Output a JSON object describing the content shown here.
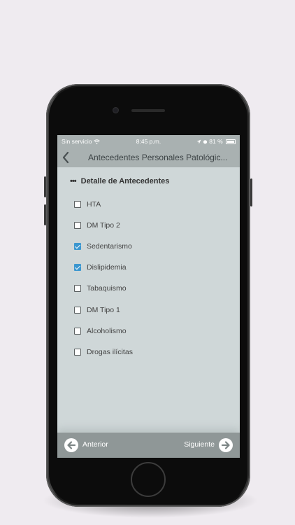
{
  "status_bar": {
    "carrier": "Sin servicio",
    "time": "8:45 p.m.",
    "battery": "81 %"
  },
  "nav": {
    "back_icon": "chevron-left-icon",
    "title": "Antecedentes Personales Patológic..."
  },
  "section": {
    "dots": "•••",
    "title": "Detalle de Antecedentes"
  },
  "options": [
    {
      "label": "HTA",
      "checked": false
    },
    {
      "label": "DM Tipo 2",
      "checked": false
    },
    {
      "label": "Sedentarismo",
      "checked": true
    },
    {
      "label": "Dislipidemia",
      "checked": true
    },
    {
      "label": "Tabaquismo",
      "checked": false
    },
    {
      "label": "DM Tipo 1",
      "checked": false
    },
    {
      "label": "Alcoholismo",
      "checked": false
    },
    {
      "label": "Drogas ilícitas",
      "checked": false
    }
  ],
  "footer": {
    "prev_label": "Anterior",
    "next_label": "Siguiente",
    "prev_icon": "arrow-left-circle-icon",
    "next_icon": "arrow-right-circle-icon"
  },
  "colors": {
    "accent": "#3c97cf",
    "screen_bg": "#cfd7d8",
    "bar_bg": "#a9b1b1",
    "footer_bg": "#8f9797"
  }
}
